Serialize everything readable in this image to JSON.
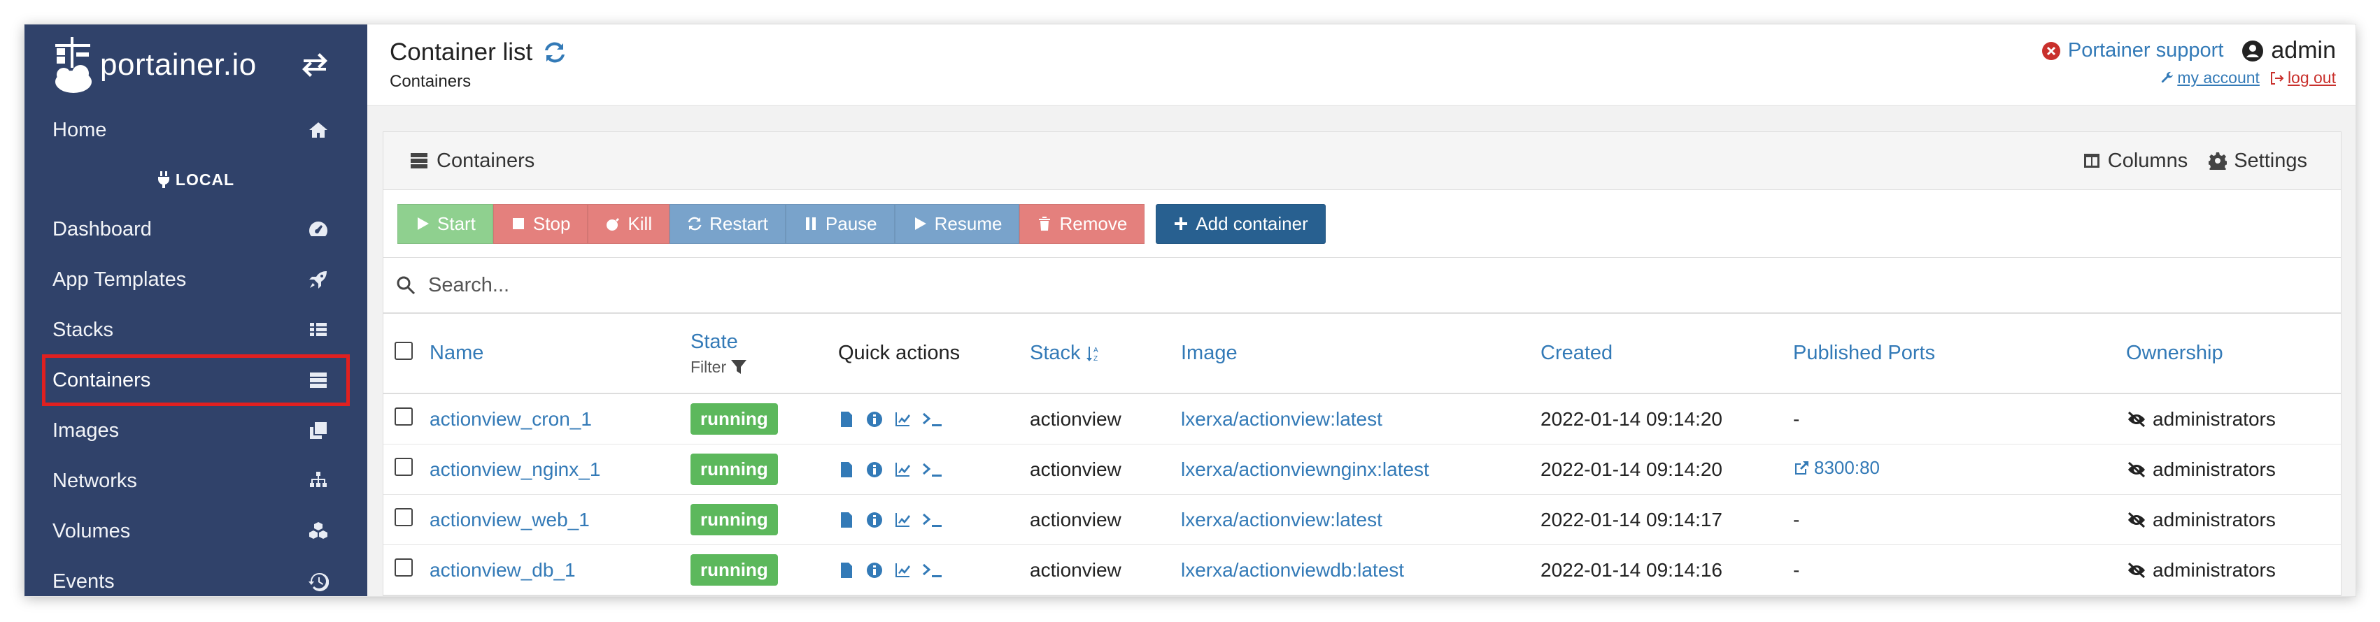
{
  "brand": {
    "name": "portainer.io"
  },
  "sidebar": {
    "environment": "LOCAL",
    "items": [
      {
        "label": "Home",
        "icon": "home-icon"
      },
      {
        "label": "Dashboard",
        "icon": "dashboard-icon"
      },
      {
        "label": "App Templates",
        "icon": "rocket-icon"
      },
      {
        "label": "Stacks",
        "icon": "list-icon"
      },
      {
        "label": "Containers",
        "icon": "server-icon",
        "active": true
      },
      {
        "label": "Images",
        "icon": "clone-icon"
      },
      {
        "label": "Networks",
        "icon": "sitemap-icon"
      },
      {
        "label": "Volumes",
        "icon": "cubes-icon"
      },
      {
        "label": "Events",
        "icon": "history-icon"
      }
    ]
  },
  "header": {
    "title": "Container list",
    "breadcrumb": "Containers",
    "support": "Portainer support",
    "user": "admin",
    "my_account": "my account",
    "log_out": "log out"
  },
  "widget": {
    "title": "Containers",
    "columns_label": "Columns",
    "settings_label": "Settings",
    "actions": {
      "start": "Start",
      "stop": "Stop",
      "kill": "Kill",
      "restart": "Restart",
      "pause": "Pause",
      "resume": "Resume",
      "remove": "Remove",
      "add": "Add container"
    },
    "search_placeholder": "Search...",
    "columns": {
      "name": "Name",
      "state": "State",
      "filter": "Filter",
      "quick_actions": "Quick actions",
      "stack": "Stack",
      "image": "Image",
      "created": "Created",
      "ports": "Published Ports",
      "ownership": "Ownership"
    },
    "rows": [
      {
        "name": "actionview_cron_1",
        "state": "running",
        "stack": "actionview",
        "image": "lxerxa/actionview:latest",
        "created": "2022-01-14 09:14:20",
        "ports": "-",
        "ownership": "administrators"
      },
      {
        "name": "actionview_nginx_1",
        "state": "running",
        "stack": "actionview",
        "image": "lxerxa/actionviewnginx:latest",
        "created": "2022-01-14 09:14:20",
        "ports": "8300:80",
        "ownership": "administrators"
      },
      {
        "name": "actionview_web_1",
        "state": "running",
        "stack": "actionview",
        "image": "lxerxa/actionview:latest",
        "created": "2022-01-14 09:14:17",
        "ports": "-",
        "ownership": "administrators"
      },
      {
        "name": "actionview_db_1",
        "state": "running",
        "stack": "actionview",
        "image": "lxerxa/actionviewdb:latest",
        "created": "2022-01-14 09:14:16",
        "ports": "-",
        "ownership": "administrators"
      }
    ]
  },
  "colors": {
    "sidebar": "#30426a",
    "link": "#337ab7",
    "running": "#5cb85c",
    "start": "#8fd08f",
    "danger": "#e4807d",
    "info": "#79a3cb",
    "primary": "#286090",
    "highlight": "#e02020"
  }
}
